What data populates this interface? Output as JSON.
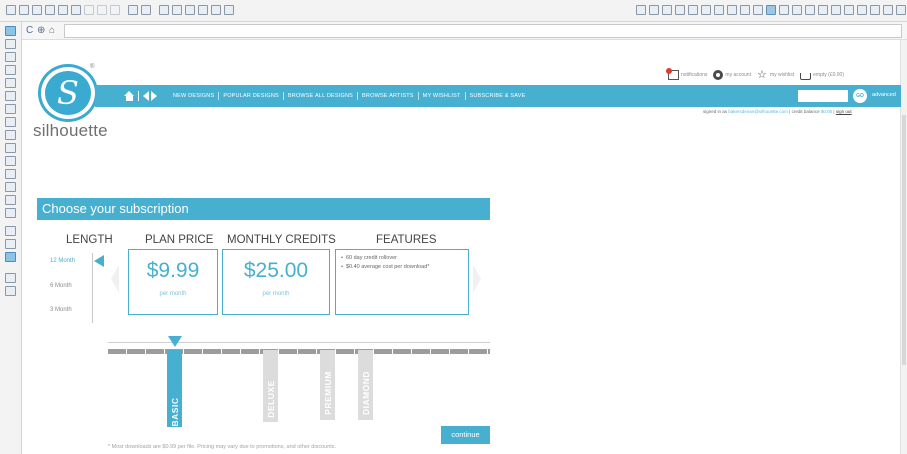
{
  "colors": {
    "accent": "#47b0d1",
    "tier_inactive": "#dcdcdc",
    "notification_dot": "#e23a2c"
  },
  "app": {
    "toolbar_icons": [
      "new-icon",
      "open-icon",
      "save-icon",
      "print-icon",
      "cut-icon",
      "copy-icon",
      "paste-icon",
      "undo-icon",
      "redo-icon",
      "pan-icon",
      "zoom-in-icon",
      "zoom-out-icon",
      "zoom-fit-icon",
      "settings-icon"
    ],
    "side_icons": [
      "select-icon",
      "edit-points-icon",
      "line-icon",
      "rectangle-icon",
      "ellipse-icon",
      "polygon-icon",
      "curve-icon",
      "freehand-icon",
      "text-icon",
      "eraser-icon",
      "knife-icon",
      "fill-icon",
      "library-icon",
      "store-icon",
      "cut-settings-icon"
    ],
    "nav_glyphs": [
      "C",
      "⊕",
      "⌂"
    ]
  },
  "site": {
    "logo_letter": "S",
    "logo_reg": "®",
    "logo_word": "silhouette",
    "nav": [
      "NEW DESIGNS",
      "POPULAR DESIGNS",
      "BROWSE ALL DESIGNS",
      "BROWSE ARTISTS",
      "MY WISHLIST",
      "SUBSCRIBE & SAVE"
    ],
    "search_placeholder": "",
    "go_label": "GO",
    "advanced_label": "advanced",
    "account": {
      "notifications": "notifications",
      "my_account": "my account",
      "my_wishlist": "my wishlist",
      "cart": "empty (£0.00)"
    },
    "signed_in": {
      "prefix": "signed in as",
      "email": "bakersdenan@silhouette.com",
      "credit_label": "| credit balance",
      "credit_value": "$0.00",
      "sign_out": "sign out"
    }
  },
  "subscription": {
    "title": "Choose your subscription",
    "headers": {
      "length": "LENGTH",
      "plan_price": "PLAN PRICE",
      "monthly_credits": "MONTHLY CREDITS",
      "features": "FEATURES"
    },
    "lengths": [
      "12 Month",
      "6 Month",
      "3 Month"
    ],
    "selected_length": "12 Month",
    "plan_price": "$9.99",
    "plan_price_unit": "per month",
    "monthly_credits": "$25.00",
    "monthly_credits_unit": "per month",
    "features": [
      "60 day credit rollover",
      "$0.40 average cost per download*"
    ],
    "tiers": [
      "BASIC",
      "DELUXE",
      "PREMIUM",
      "DIAMOND"
    ],
    "selected_tier": "BASIC",
    "continue_label": "continue",
    "footnote": "* Most downloads are $0.99 per file. Pricing may vary due to promotions, and other discounts."
  }
}
